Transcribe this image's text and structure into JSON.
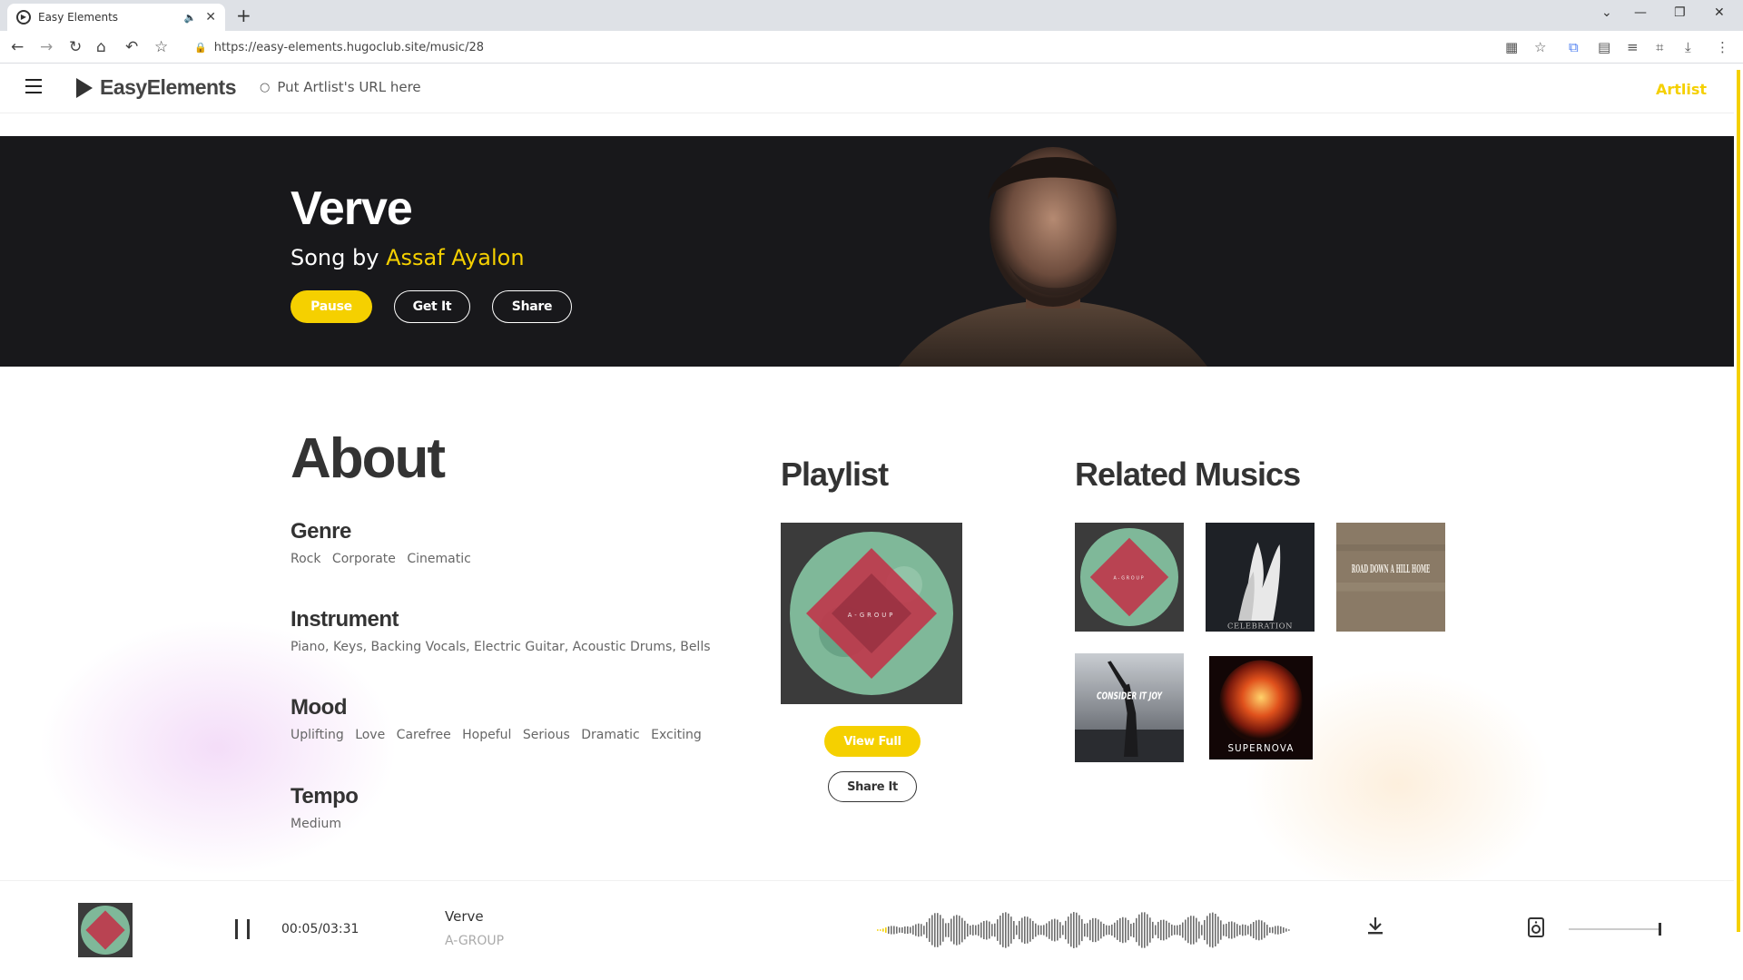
{
  "browser": {
    "tab_title": "Easy Elements",
    "url": "https://easy-elements.hugoclub.site/music/28"
  },
  "header": {
    "brand": "EasyElements",
    "search_placeholder": "Put Artlist's URL here",
    "partner": "Artlist"
  },
  "hero": {
    "title": "Verve",
    "subtitle_prefix": "Song by",
    "artist": "Assaf Ayalon",
    "buttons": {
      "pause": "Pause",
      "get": "Get It",
      "share": "Share"
    }
  },
  "about": {
    "title": "About",
    "genre": {
      "label": "Genre",
      "values": [
        "Rock",
        "Corporate",
        "Cinematic"
      ]
    },
    "instrument": {
      "label": "Instrument",
      "text": "Piano, Keys, Backing Vocals, Electric Guitar, Acoustic Drums, Bells"
    },
    "mood": {
      "label": "Mood",
      "values": [
        "Uplifting",
        "Love",
        "Carefree",
        "Hopeful",
        "Serious",
        "Dramatic",
        "Exciting"
      ]
    },
    "tempo": {
      "label": "Tempo",
      "value": "Medium"
    }
  },
  "playlist": {
    "title": "Playlist",
    "cover_text": "A-GROUP",
    "view_full": "View Full",
    "share_it": "Share It"
  },
  "related": {
    "title": "Related Musics",
    "covers": [
      {
        "name": "a-group",
        "text": "A-GROUP"
      },
      {
        "name": "celebration",
        "text": "CELEBRATION"
      },
      {
        "name": "road-down-a-hill-home",
        "text": "ROAD DOWN A HILL HOME"
      },
      {
        "name": "consider-it-joy",
        "text": "CONSIDER IT JOY"
      },
      {
        "name": "supernova",
        "text": "SUPERNOVA"
      }
    ]
  },
  "player": {
    "time": "00:05/03:31",
    "title": "Verve",
    "artist": "A-GROUP",
    "progress": 0.024,
    "volume": 1.0
  },
  "colors": {
    "accent": "#f5d000",
    "hero_bg": "#18181b"
  }
}
